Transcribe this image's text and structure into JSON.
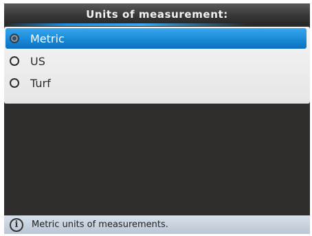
{
  "dialog": {
    "title": "Units of measurement:"
  },
  "options": [
    {
      "label": "Metric",
      "selected": true
    },
    {
      "label": "US",
      "selected": false
    },
    {
      "label": "Turf",
      "selected": false
    }
  ],
  "status": {
    "icon": "info-icon",
    "text": "Metric units of measurements."
  },
  "colors": {
    "accent": "#1a8ad8",
    "background": "#2e2d2b"
  }
}
